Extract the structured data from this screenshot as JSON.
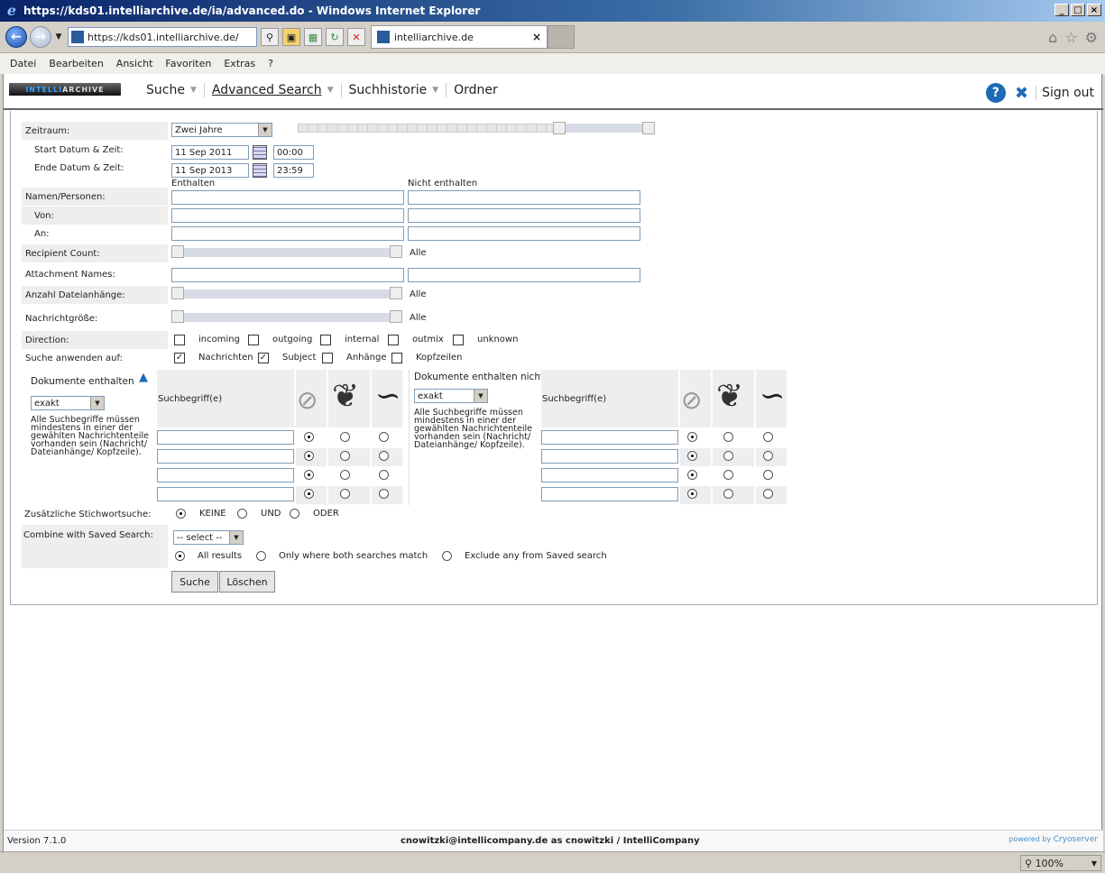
{
  "window": {
    "title": "https://kds01.intelliarchive.de/ia/advanced.do - Windows Internet Explorer",
    "controls": [
      "_",
      "□",
      "×"
    ]
  },
  "browser": {
    "address": "https://kds01.intelliarchive.de/",
    "tab_title": "intelliarchive.de",
    "tab_close": "×",
    "menu": [
      "Datei",
      "Bearbeiten",
      "Ansicht",
      "Favoriten",
      "Extras",
      "?"
    ],
    "zoom": "100%"
  },
  "app": {
    "logo": {
      "part1": "INTELLI",
      "part2": "ARCHIVE"
    },
    "nav": [
      {
        "label": "Suche"
      },
      {
        "label": "Advanced Search"
      },
      {
        "label": "Suchhistorie"
      },
      {
        "label": "Ordner"
      }
    ],
    "help": "?",
    "sign_out": "Sign out"
  },
  "form": {
    "zeitraum": {
      "label": "Zeitraum:",
      "value": "Zwei Jahre",
      "slider_start_fraction": 0.74,
      "slider_end_fraction": 1.0
    },
    "start": {
      "label": "Start Datum & Zeit:",
      "date": "11 Sep 2011",
      "time": "00:00"
    },
    "end": {
      "label": "Ende Datum & Zeit:",
      "date": "11 Sep 2013",
      "time": "23:59"
    },
    "col_contains": "Enthalten",
    "col_not_contains": "Nicht enthalten",
    "namen": {
      "label": "Namen/Personen:"
    },
    "von": {
      "label": "Von:"
    },
    "an": {
      "label": "An:"
    },
    "recipient": {
      "label": "Recipient Count:",
      "value": "Alle"
    },
    "attachment_names": {
      "label": "Attachment Names:"
    },
    "anzahl": {
      "label": "Anzahl Dateianhänge:",
      "value": "Alle"
    },
    "groesse": {
      "label": "Nachrichtgröße:",
      "value": "Alle"
    },
    "direction": {
      "label": "Direction:",
      "options": [
        {
          "label": "incoming",
          "checked": false
        },
        {
          "label": "outgoing",
          "checked": false
        },
        {
          "label": "internal",
          "checked": false
        },
        {
          "label": "outmix",
          "checked": false
        },
        {
          "label": "unknown",
          "checked": false
        }
      ]
    },
    "apply": {
      "label": "Suche anwenden auf:",
      "options": [
        {
          "label": "Nachrichten",
          "checked": true
        },
        {
          "label": "Subject",
          "checked": true
        },
        {
          "label": "Anhänge",
          "checked": false
        },
        {
          "label": "Kopfzeilen",
          "checked": false
        }
      ]
    },
    "contains_block": {
      "title": "Dokumente enthalten",
      "mode": "exakt",
      "hint": "Alle Suchbegriffe müssen mindestens in einer der gewählten Nachrichtenteile vorhanden sein (Nachricht/ Dateianhänge/ Kopfzeile).",
      "column": "Suchbegriff(e)",
      "icons": [
        "no-icon",
        "leaf-icon",
        "ear-icon"
      ]
    },
    "not_contains_block": {
      "title": "Dokumente enthalten nicht",
      "mode": "exakt",
      "hint": "Alle Suchbegriffe müssen mindestens in einer der gewählten Nachrichtenteile vorhanden sein (Nachricht/ Dateianhänge/ Kopfzeile).",
      "column": "Suchbegriff(e)"
    },
    "extra_keyword": {
      "label": "Zusätzliche Stichwortsuche:",
      "options": [
        {
          "label": "KEINE",
          "selected": true
        },
        {
          "label": "UND",
          "selected": false
        },
        {
          "label": "ODER",
          "selected": false
        }
      ]
    },
    "combine": {
      "label": "Combine with Saved Search:",
      "select": "-- select --",
      "options": [
        {
          "label": "All results",
          "selected": true
        },
        {
          "label": "Only where both searches match",
          "selected": false
        },
        {
          "label": "Exclude any from Saved search",
          "selected": false
        }
      ]
    },
    "buttons": {
      "search": "Suche",
      "clear": "Löschen"
    }
  },
  "footer": {
    "version": "Version 7.1.0",
    "user": "cnowitzki@intellicompany.de as cnowitzki / IntelliCompany",
    "powered_by": "powered by",
    "brand": "Cryoserver"
  }
}
